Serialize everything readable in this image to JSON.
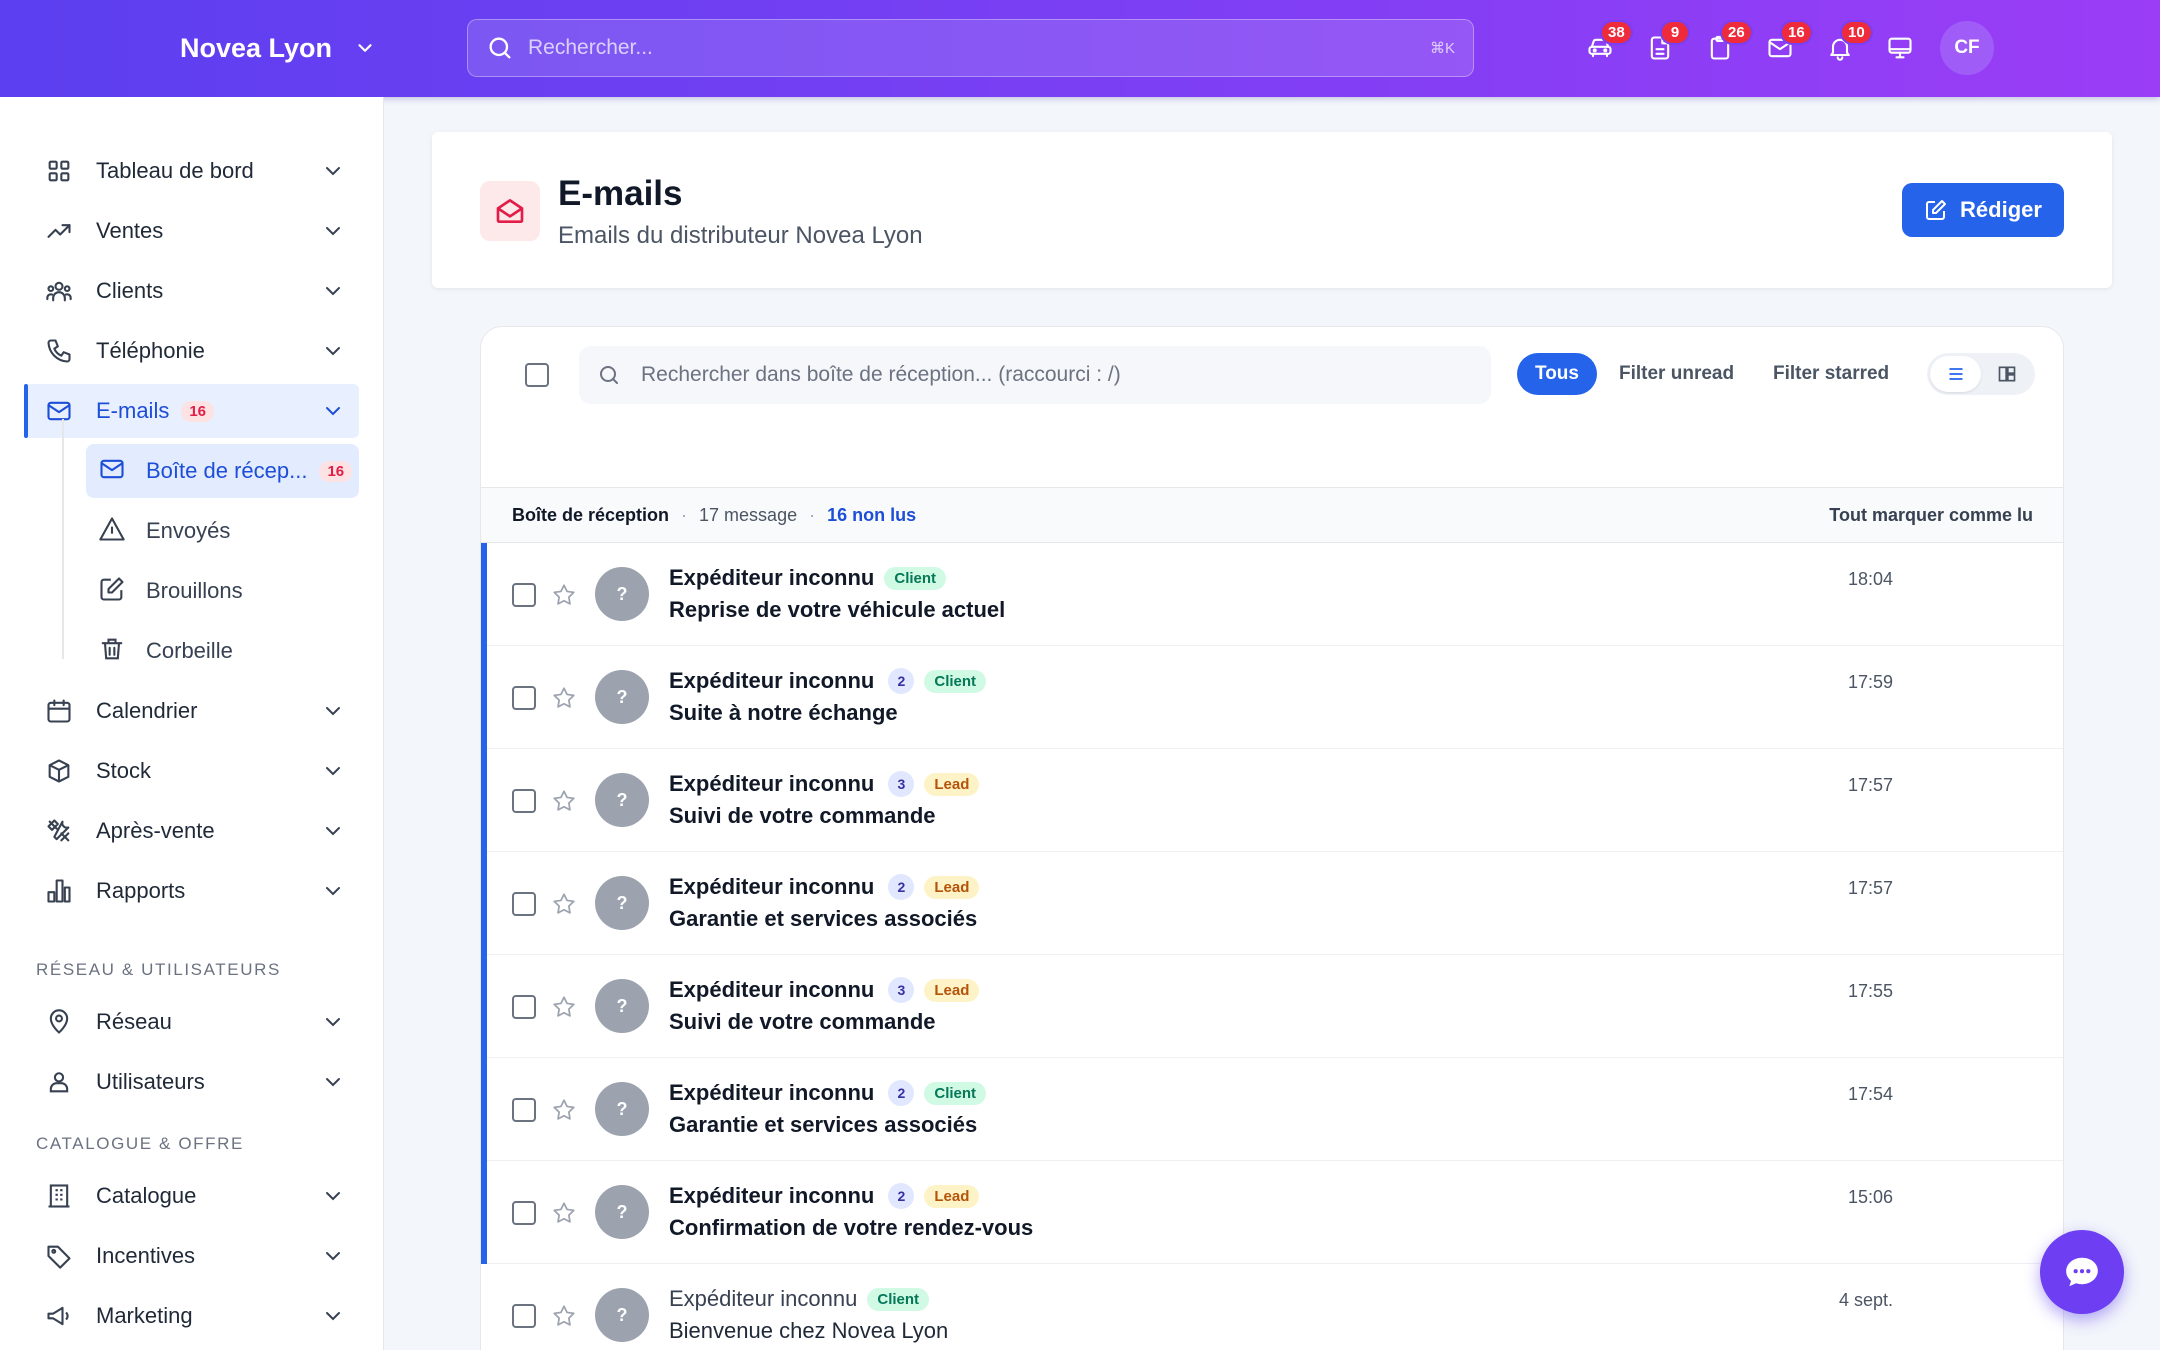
{
  "topbar": {
    "brand": "Novea Lyon",
    "search_placeholder": "Rechercher...",
    "search_shortcut": "⌘K",
    "icons": [
      {
        "name": "car-icon",
        "badge": "38"
      },
      {
        "name": "document-icon",
        "badge": "9"
      },
      {
        "name": "clipboard-icon",
        "badge": "26"
      },
      {
        "name": "mail-icon",
        "badge": "16"
      },
      {
        "name": "bell-icon",
        "badge": "10"
      },
      {
        "name": "monitor-icon",
        "badge": ""
      }
    ],
    "avatar_initials": "CF"
  },
  "sidebar": {
    "items": [
      {
        "label": "Tableau de bord",
        "icon": "dashboard-icon"
      },
      {
        "label": "Ventes",
        "icon": "trending-up-icon"
      },
      {
        "label": "Clients",
        "icon": "users-icon"
      },
      {
        "label": "Téléphonie",
        "icon": "phone-icon"
      },
      {
        "label": "E-mails",
        "icon": "mail-icon",
        "badge": "16"
      },
      {
        "label": "Calendrier",
        "icon": "calendar-icon"
      },
      {
        "label": "Stock",
        "icon": "box-icon"
      },
      {
        "label": "Après-vente",
        "icon": "tools-icon"
      },
      {
        "label": "Rapports",
        "icon": "chart-icon"
      }
    ],
    "email_subitems": [
      {
        "label": "Boîte de récep...",
        "icon": "inbox-icon",
        "badge": "16"
      },
      {
        "label": "Envoyés",
        "icon": "send-icon"
      },
      {
        "label": "Brouillons",
        "icon": "edit-icon"
      },
      {
        "label": "Corbeille",
        "icon": "trash-icon"
      }
    ],
    "section_network": "RÉSEAU & UTILISATEURS",
    "network_items": [
      {
        "label": "Réseau",
        "icon": "map-pin-icon"
      },
      {
        "label": "Utilisateurs",
        "icon": "user-group-icon"
      }
    ],
    "section_catalog": "CATALOGUE & OFFRE",
    "catalog_items": [
      {
        "label": "Catalogue",
        "icon": "building-icon"
      },
      {
        "label": "Incentives",
        "icon": "tag-icon"
      },
      {
        "label": "Marketing",
        "icon": "megaphone-icon"
      }
    ]
  },
  "header": {
    "title": "E-mails",
    "subtitle": "Emails du distributeur Novea Lyon",
    "compose_label": "Rédiger"
  },
  "inbox": {
    "search_placeholder": "Rechercher dans boîte de réception... (raccourci : /)",
    "filters": {
      "all": "Tous",
      "unread": "Filter unread",
      "starred": "Filter starred"
    },
    "bar": {
      "name": "Boîte de réception",
      "count": "17 message",
      "unread": "16 non lus",
      "mark_all": "Tout marquer comme lu"
    },
    "messages": [
      {
        "avatar": "?",
        "sender": "Expéditeur inconnu",
        "thread": "",
        "tag": "Client",
        "subject": "Reprise de votre véhicule actuel",
        "time": "18:04",
        "unread": true
      },
      {
        "avatar": "?",
        "sender": "Expéditeur inconnu",
        "thread": "2",
        "tag": "Client",
        "subject": "Suite à notre échange",
        "time": "17:59",
        "unread": true
      },
      {
        "avatar": "?",
        "sender": "Expéditeur inconnu",
        "thread": "3",
        "tag": "Lead",
        "subject": "Suivi de votre commande",
        "time": "17:57",
        "unread": true
      },
      {
        "avatar": "?",
        "sender": "Expéditeur inconnu",
        "thread": "2",
        "tag": "Lead",
        "subject": "Garantie et services associés",
        "time": "17:57",
        "unread": true
      },
      {
        "avatar": "?",
        "sender": "Expéditeur inconnu",
        "thread": "3",
        "tag": "Lead",
        "subject": "Suivi de votre commande",
        "time": "17:55",
        "unread": true
      },
      {
        "avatar": "?",
        "sender": "Expéditeur inconnu",
        "thread": "2",
        "tag": "Client",
        "subject": "Garantie et services associés",
        "time": "17:54",
        "unread": true
      },
      {
        "avatar": "?",
        "sender": "Expéditeur inconnu",
        "thread": "2",
        "tag": "Lead",
        "subject": "Confirmation de votre rendez-vous",
        "time": "15:06",
        "unread": true
      },
      {
        "avatar": "?",
        "sender": "Expéditeur inconnu",
        "thread": "",
        "tag": "Client",
        "subject": "Bienvenue chez Novea Lyon",
        "time": "4 sept.",
        "unread": false
      }
    ]
  },
  "colors": {
    "accent": "#2563eb",
    "brand_gradient_start": "#5b3ff0",
    "brand_gradient_end": "#9b3df7",
    "badge": "#ef2b3b"
  }
}
